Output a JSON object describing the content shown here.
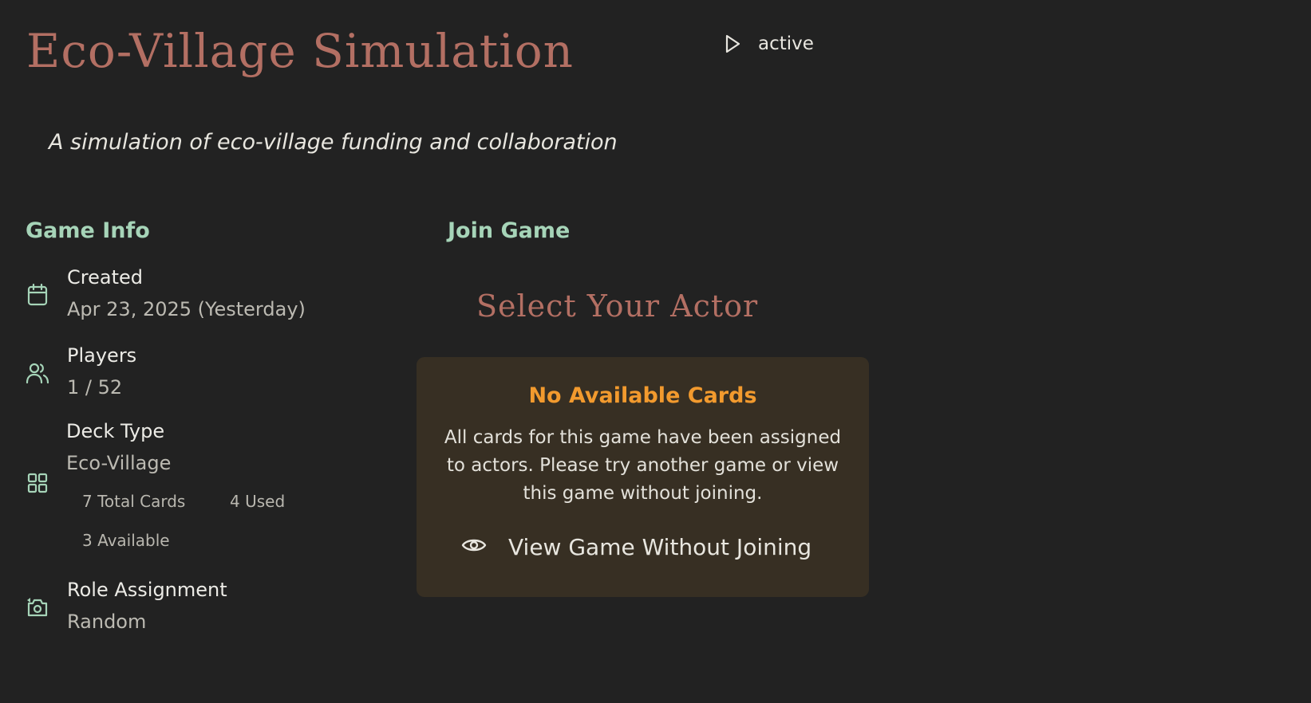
{
  "header": {
    "title": "Eco-Village Simulation",
    "status": "active",
    "status_icon": "play-icon"
  },
  "subtitle": "A simulation of eco-village funding and collaboration",
  "game_info": {
    "heading": "Game Info",
    "created": {
      "label": "Created",
      "value": "Apr 23, 2025 (Yesterday)",
      "icon": "calendar-icon"
    },
    "players": {
      "label": "Players",
      "value": "1 / 52",
      "icon": "users-icon"
    },
    "deck": {
      "label": "Deck Type",
      "value": "Eco-Village",
      "icon": "grid-icon",
      "total": "7 Total Cards",
      "used": "4 Used",
      "available": "3 Available"
    },
    "role": {
      "label": "Role Assignment",
      "value": "Random",
      "icon": "shuffle-camera-icon"
    }
  },
  "join": {
    "heading": "Join Game",
    "actor_heading": "Select Your Actor",
    "notice": {
      "title": "No Available Cards",
      "body": "All cards for this game have been assigned to actors. Please try another game or view this game without joining."
    },
    "view_button": {
      "label": "View Game Without Joining",
      "icon": "eye-icon"
    }
  },
  "colors": {
    "background": "#222222",
    "title": "#b36f63",
    "section_heading": "#a6d4b8",
    "warning": "#f29a2e",
    "notice_background": "#372f23"
  }
}
